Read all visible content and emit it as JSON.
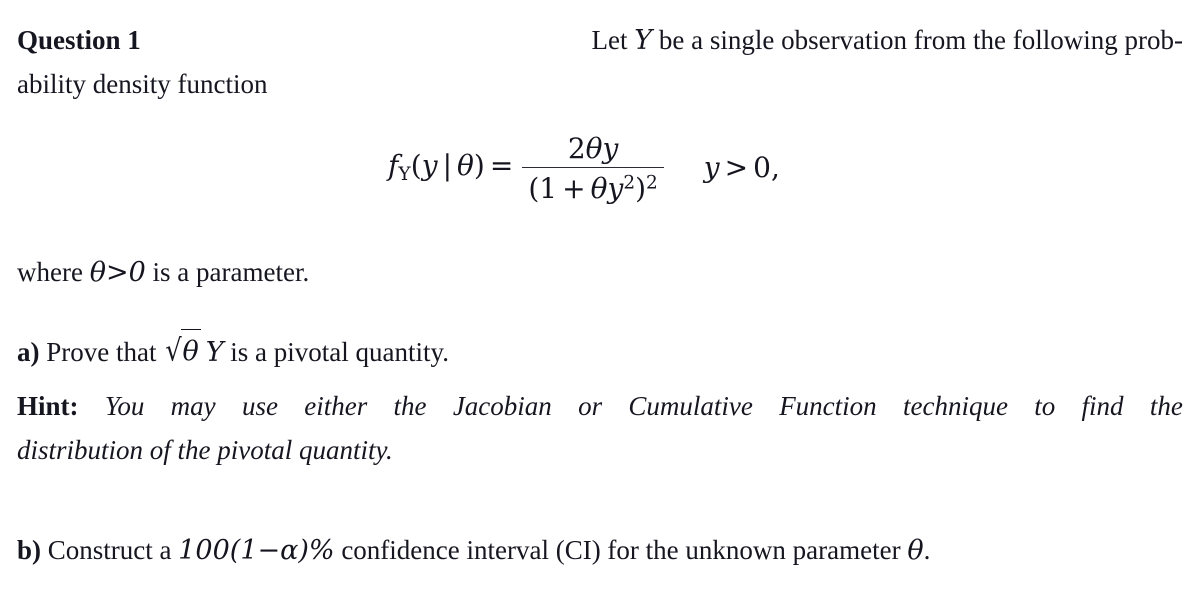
{
  "document": {
    "type": "math-problem-statement",
    "background_color": "#ffffff",
    "text_color": "#161620"
  },
  "question": {
    "heading": "Question 1",
    "intro_line1": "Let Y be a single observation from the following prob-",
    "intro_line1_pre": "Let ",
    "intro_line1_var": "Y",
    "intro_line1_post": " be a single observation from the following prob-",
    "intro_line2": "ability density function"
  },
  "equation": {
    "lhs_f": "f",
    "lhs_sub": "Y",
    "lhs_open": "(",
    "lhs_y": "y",
    "lhs_mid": "|",
    "lhs_theta": "θ",
    "lhs_close": ")",
    "equals": "=",
    "numerator_coeff": "2",
    "numerator_theta": "θ",
    "numerator_y": "y",
    "denominator_open": "(1",
    "denominator_plus": "+",
    "denominator_theta": "θ",
    "denominator_y": "y",
    "denominator_inner_exp": "2",
    "denominator_close": ")",
    "denominator_outer_exp": "2",
    "condition_var": "y",
    "condition_op": ">",
    "condition_value": "0,",
    "plain_text": "f_Y(y | θ) = 2θy / (1 + θy²)²,  y > 0,"
  },
  "where_clause": {
    "pre": "where ",
    "theta": "θ",
    "op": ">",
    "value": "0",
    "post": " is a parameter.",
    "plain_text": "where θ > 0 is a parameter."
  },
  "part_a": {
    "label": "a)",
    "pre": " Prove that ",
    "sqrt_symbol": "√",
    "sqrt_radicand": "θ",
    "variable": "Y",
    "post": " is a pivotal quantity.",
    "plain_text": "a) Prove that √θ Y is a pivotal quantity."
  },
  "hint": {
    "label": "Hint:",
    "line1_words": [
      "You",
      "may",
      "use",
      "either",
      "the",
      "Jacobian",
      "or",
      "Cumulative",
      "Function",
      "technique",
      "to",
      "find",
      "the"
    ],
    "line1": "You may use either the Jacobian or Cumulative Function technique to find the",
    "line2": "distribution of the pivotal quantity.",
    "plain_text": "Hint: You may use either the Jacobian or Cumulative Function technique to find the distribution of the pivotal quantity."
  },
  "part_b": {
    "label": "b)",
    "pre": " Construct a ",
    "math_100": "100(1",
    "math_minus": "−",
    "math_alpha": "α",
    "math_close": ")%",
    "post": " confidence interval (CI) for the unknown parameter ",
    "theta": "θ",
    "period": ".",
    "plain_text": "b) Construct a 100(1 − α)% confidence interval (CI) for the unknown parameter θ."
  }
}
